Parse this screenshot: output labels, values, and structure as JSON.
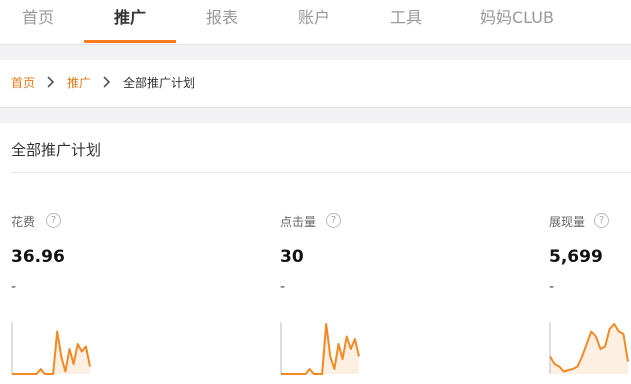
{
  "nav": {
    "tabs": [
      {
        "label": "首页"
      },
      {
        "label": "推广"
      },
      {
        "label": "报表"
      },
      {
        "label": "账户"
      },
      {
        "label": "工具"
      },
      {
        "label": "妈妈CLUB"
      }
    ],
    "active_tab": "推广",
    "accent_color": "#ff7a1a"
  },
  "breadcrumb": {
    "items": [
      "首页",
      "推广",
      "全部推广计划"
    ]
  },
  "main": {
    "title": "全部推广计划",
    "metrics": [
      {
        "label": "花费",
        "help": "?",
        "value": "36.96",
        "delta": "-"
      },
      {
        "label": "点击量",
        "help": "?",
        "value": "30",
        "delta": "-"
      },
      {
        "label": "展现量",
        "help": "?",
        "value": "5,699",
        "delta": "-"
      }
    ]
  },
  "sparklines": {
    "color": "#f08a24",
    "fill": "#fdf0e2",
    "series": [
      [
        0,
        0,
        0,
        0,
        0,
        0,
        0,
        0.1,
        0,
        0,
        0,
        0.85,
        0.35,
        0.05,
        0.5,
        0.2,
        0.6,
        0.45,
        0.55,
        0.15
      ],
      [
        0,
        0,
        0,
        0,
        0,
        0,
        0,
        0.1,
        0,
        0,
        0,
        1,
        0.35,
        0.1,
        0.6,
        0.3,
        0.75,
        0.5,
        0.7,
        0.35
      ],
      [
        0.35,
        0.2,
        0.15,
        0.05,
        0.08,
        0.1,
        0.15,
        0.35,
        0.6,
        0.85,
        0.75,
        0.5,
        0.55,
        0.9,
        1,
        0.85,
        0.8,
        0.25
      ]
    ]
  }
}
